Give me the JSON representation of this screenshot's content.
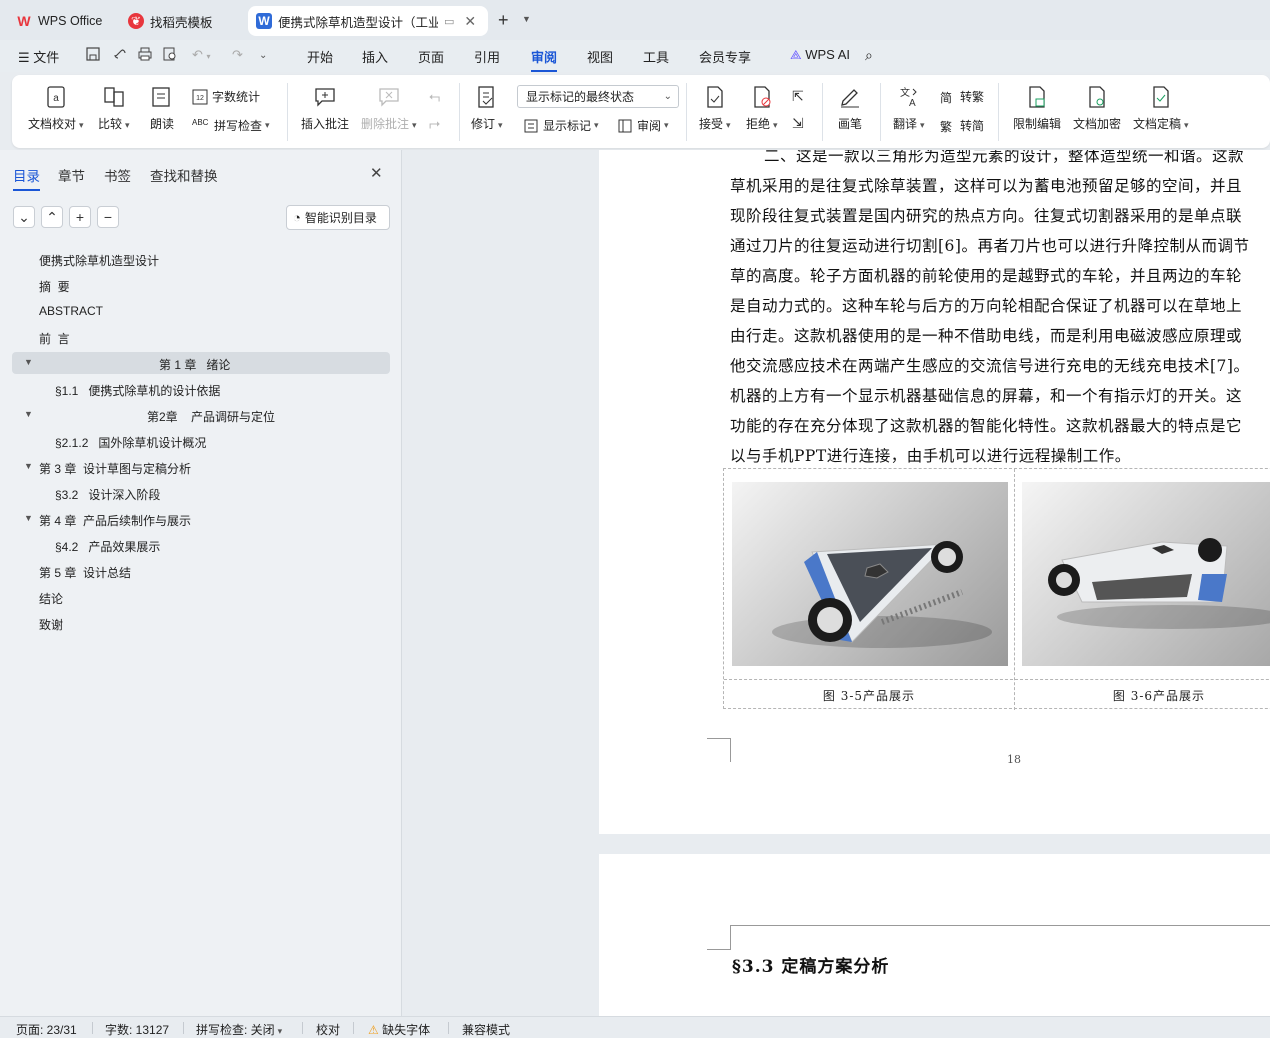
{
  "tabs": {
    "wps": "WPS Office",
    "template": "找稻壳模板",
    "doc": "便携式除草机造型设计（工业"
  },
  "menu": {
    "file": "文件",
    "items": [
      "开始",
      "插入",
      "页面",
      "引用",
      "审阅",
      "视图",
      "工具",
      "会员专享"
    ],
    "wps_ai": "WPS AI"
  },
  "ribbon": {
    "doc_check": "文档校对",
    "compare": "比较",
    "read_aloud": "朗读",
    "word_count": "字数统计",
    "spell_check": "拼写检查",
    "insert_comment": "插入批注",
    "delete_comment": "删除批注",
    "track": "修订",
    "show_markup_state": "显示标记的最终状态",
    "show_markup": "显示标记",
    "review": "审阅",
    "accept": "接受",
    "reject": "拒绝",
    "pen": "画笔",
    "translate": "翻译",
    "to_trad": "转繁",
    "to_simp": "转简",
    "restrict": "限制编辑",
    "encrypt": "文档加密",
    "finalize": "文档定稿"
  },
  "nav": {
    "tabs": [
      "目录",
      "章节",
      "书签",
      "查找和替换"
    ],
    "smart_toc": "智能识别目录",
    "toc": [
      "便携式除草机造型设计",
      "摘  要",
      "ABSTRACT",
      "前  言",
      "第 1 章   绪论",
      "§1.1   便携式除草机的设计依据",
      "第2章    产品调研与定位",
      "§2.1.2   国外除草机设计概况",
      "第 3 章  设计草图与定稿分析",
      "§3.2   设计深入阶段",
      "第 4 章  产品后续制作与展示",
      "§4.2   产品效果展示",
      "第 5 章  设计总结",
      "结论",
      "致谢"
    ]
  },
  "doc": {
    "lines": [
      "二、这是一款以三角形为造型元素的设计，整体造型统一和谐。这款",
      "草机采用的是往复式除草装置，这样可以为蓄电池预留足够的空间，并且",
      "现阶段往复式装置是国内研究的热点方向。往复式切割器采用的是单点联",
      "通过刀片的往复运动进行切割[6]。再者刀片也可以进行升降控制从而调节",
      "草的高度。轮子方面机器的前轮使用的是越野式的车轮，并且两边的车轮",
      "是自动力式的。这种车轮与后方的万向轮相配合保证了机器可以在草地上",
      "由行走。这款机器使用的是一种不借助电线，而是利用电磁波感应原理或",
      "他交流感应技术在两端产生感应的交流信号进行充电的无线充电技术[7]。",
      "机器的上方有一个显示机器基础信息的屏幕，和一个有指示灯的开关。这",
      "功能的存在充分体现了这款机器的智能化特性。这款机器最大的特点是它",
      "以与手机PPT进行连接，由手机可以进行远程操制工作。"
    ],
    "caption1": "图 3-5产品展示",
    "caption2": "图 3-6产品展示",
    "page_number": "18",
    "heading": "§3.3  定稿方案分析"
  },
  "status": {
    "page": "页面: 23/31",
    "words": "字数: 13127",
    "spell": "拼写检查: 关闭",
    "proof": "校对",
    "missing_font": "缺失字体",
    "compat": "兼容模式"
  },
  "colors": {
    "accent": "#1a56d6",
    "wps_red": "#e8363d"
  }
}
